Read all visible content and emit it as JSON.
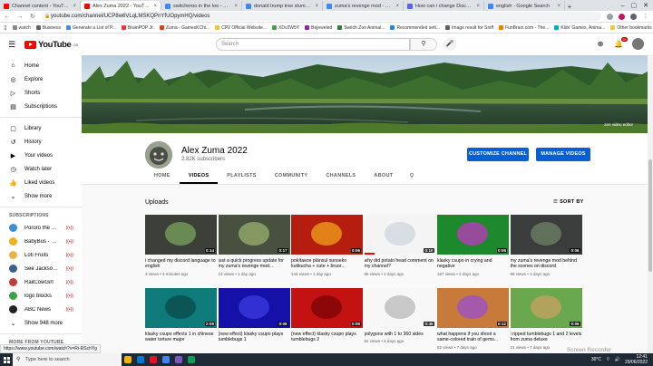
{
  "browser": {
    "tabs": [
      {
        "title": "Channel content - YouTube Stu...",
        "fav": "#ff0000",
        "active": false
      },
      {
        "title": "Alex Zuma 2022 - YouTube",
        "fav": "#ff0000",
        "active": true
      },
      {
        "title": "switcheroo in the loo - Google...",
        "fav": "#4285f4",
        "active": false
      },
      {
        "title": "donald trump tree stump - Go...",
        "fav": "#4285f4",
        "active": false
      },
      {
        "title": "zuma's revenge mod - Google...",
        "fav": "#4285f4",
        "active": false
      },
      {
        "title": "How can i change Discord's La...",
        "fav": "#5865f2",
        "active": false
      },
      {
        "title": "english - Google Search",
        "fav": "#4285f4",
        "active": false
      }
    ],
    "url": "youtube.com/channel/UCP8w6VLqLMSKQPnYfUOpymHQ/videos",
    "bookmarks": [
      "watch",
      "Business",
      "Generate a List of P...",
      "BrainPOP Jr.",
      "Zuma - GamesKChi...",
      "CP2 Official Website...",
      "XDv2W5Y",
      "Bejeweled",
      "Switch Zoo Animal...",
      "Recommended sett...",
      "Image result for Sniff",
      "FunBrain.com - The...",
      "Kids' Games, Anima..."
    ],
    "other_bookmarks": "Other bookmarks",
    "status_url": "https://www.youtube.com/watch?v=Ri-RSchYg"
  },
  "yt": {
    "logo_text": "YouTube",
    "region": "GB",
    "search_placeholder": "Search",
    "notif_count": "9+"
  },
  "sidebar": {
    "main": [
      {
        "label": "Home",
        "icon": "⌂",
        "name": "home"
      },
      {
        "label": "Explore",
        "icon": "◎",
        "name": "explore"
      },
      {
        "label": "Shorts",
        "icon": "▷",
        "name": "shorts"
      },
      {
        "label": "Subscriptions",
        "icon": "▤",
        "name": "subscriptions"
      }
    ],
    "library": [
      {
        "label": "Library",
        "icon": "▢",
        "name": "library"
      },
      {
        "label": "History",
        "icon": "↺",
        "name": "history"
      },
      {
        "label": "Your videos",
        "icon": "▶",
        "name": "your-videos"
      },
      {
        "label": "Watch later",
        "icon": "◷",
        "name": "watch-later"
      },
      {
        "label": "Liked videos",
        "icon": "👍",
        "name": "liked-videos"
      },
      {
        "label": "Show more",
        "icon": "⌄",
        "name": "show-more"
      }
    ],
    "subscriptions_heading": "SUBSCRIPTIONS",
    "subscriptions": [
      {
        "label": "Pororo the Little P...",
        "color": "#3b8fd6"
      },
      {
        "label": "BabyBus - Kids So...",
        "color": "#f2b21c"
      },
      {
        "label": "Lofi Fruits",
        "color": "#e9b347"
      },
      {
        "label": "See Jackson Hole",
        "color": "#3a5f8f"
      },
      {
        "label": "RailCowGirl",
        "color": "#c43b3b"
      },
      {
        "label": "logo blocks",
        "color": "#3aa14a"
      },
      {
        "label": "ABC News",
        "color": "#222222"
      }
    ],
    "show_more_subs": "Show 948 more",
    "more_heading": "MORE FROM YOUTUBE"
  },
  "channel": {
    "name": "Alex Zuma 2022",
    "subscribers": "2.82K subscribers",
    "customize_label": "CUSTOMIZE CHANNEL",
    "manage_label": "MANAGE VIDEOS",
    "video_editor": "zen video editor",
    "tabs": [
      "HOME",
      "VIDEOS",
      "PLAYLISTS",
      "COMMUNITY",
      "CHANNELS",
      "ABOUT"
    ],
    "active_tab": "VIDEOS",
    "uploads_title": "Uploads",
    "sort_label": "SORT BY"
  },
  "videos": [
    {
      "title": "i changed my discord language to english",
      "meta": "3 views • 4 minutes ago",
      "duration": "0:14",
      "bg": "#3d4038",
      "accent": "#7aa35e",
      "progress": 0
    },
    {
      "title": "just a quick progress update for my zuma's revenge mod...",
      "meta": "13 views • 1 day ago",
      "duration": "0:17",
      "bg": "#485040",
      "accent": "#9ab06e",
      "progress": 0
    },
    {
      "title": "pokítaeze plánsul sunseko kutikucha + cute + bruor...",
      "meta": "144 views • 1 day ago",
      "duration": "0:06",
      "bg": "#b51e0e",
      "accent": "#f2a21c",
      "progress": 0
    },
    {
      "title": "why did potato head comment on my channel?",
      "meta": "65 views • 2 days ago",
      "duration": "0:10",
      "bg": "#f4f4f4",
      "accent": "#cfd6de",
      "progress": 0.15
    },
    {
      "title": "klasky csupo in crying and negative",
      "meta": "167 views • 2 days ago",
      "duration": "0:06",
      "bg": "#1c8a2c",
      "accent": "#c036c0",
      "progress": 0
    },
    {
      "title": "my zuma's revenge mod behind the scenes on discord",
      "meta": "98 views • 3 days ago",
      "duration": "0:06",
      "bg": "#3a3d3b",
      "accent": "#6d8266",
      "progress": 0
    },
    {
      "title": "klasky csupo effects 1 in chinese water torture major",
      "meta": "",
      "duration": "2:09",
      "bg": "#0f7a7a",
      "accent": "#0b4b48",
      "progress": 0
    },
    {
      "title": "(new effect) klasky csupo plays tumblebugs 1",
      "meta": "",
      "duration": "0:06",
      "bg": "#1510a8",
      "accent": "#3b3be0",
      "progress": 0
    },
    {
      "title": "(new effect) klasky csupo plays tumblebugs 2",
      "meta": "",
      "duration": "0:06",
      "bg": "#c41212",
      "accent": "#7a0505",
      "progress": 0
    },
    {
      "title": "polygons with 1 to 360 sides",
      "meta": "51 views • 6 days ago",
      "duration": "0:45",
      "bg": "#f7f7f7",
      "accent": "#b8b8b8",
      "progress": 0
    },
    {
      "title": "what happens if you shoot a same-colored train of gems...",
      "meta": "52 views • 7 days ago",
      "duration": "0:12",
      "bg": "#c87a3a",
      "accent": "#9a4fd0",
      "progress": 0
    },
    {
      "title": "i ripped tumblebugs 1 and 2 levels from zuma deluxe",
      "meta": "21 views • 7 days ago",
      "duration": "0:06",
      "bg": "#6aa84f",
      "accent": "#c9a060",
      "progress": 0
    }
  ],
  "taskbar": {
    "search_placeholder": "Type here to search",
    "temp": "30°C",
    "time": "12:41",
    "date": "29/06/2022",
    "apps": [
      "#f4b400",
      "#0078d7",
      "#e81123",
      "#4285f4",
      "#7e57c2",
      "#0f9d58"
    ]
  },
  "watermark": "Screen Recorder"
}
